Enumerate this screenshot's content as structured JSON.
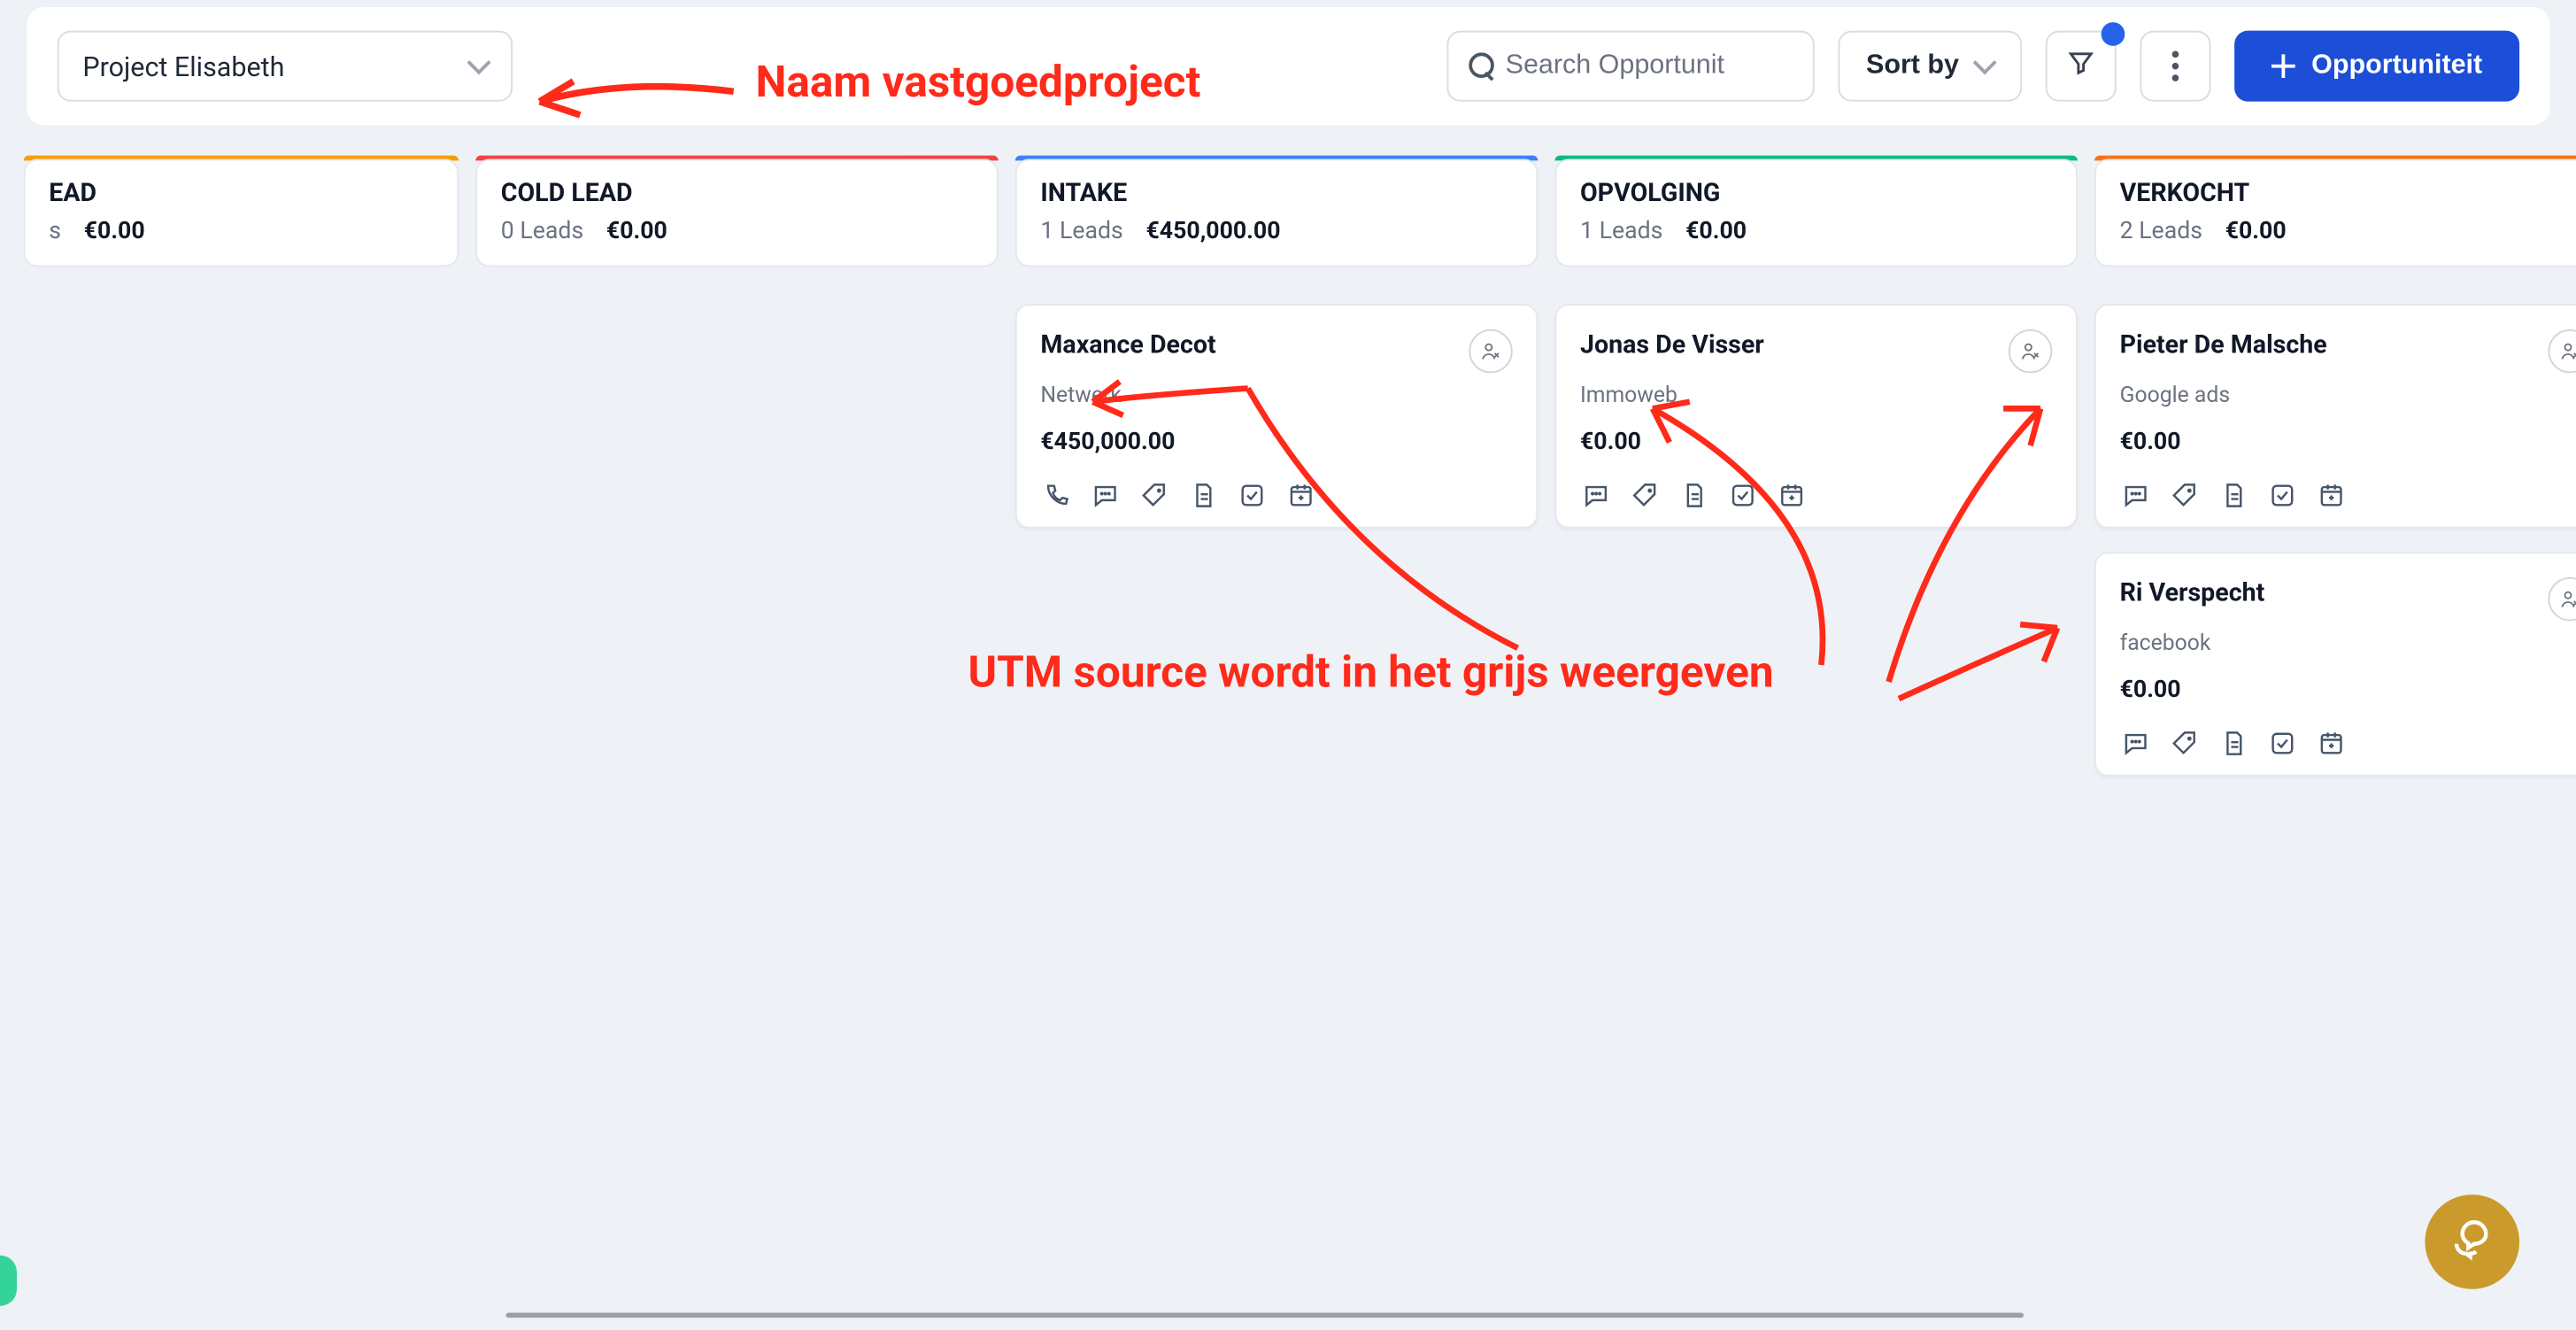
{
  "toolbar": {
    "project_name": "Project Elisabeth",
    "search_placeholder": "Search Opportunit",
    "sort_label": "Sort by",
    "add_label": "Opportuniteit"
  },
  "annotations": {
    "a1": "Naam vastgoedproject",
    "a2": "UTM source wordt in het grijs weergeven"
  },
  "columns": [
    {
      "title": "EAD",
      "sub_prefix": "s",
      "value": "€0.00",
      "bar": "yellow"
    },
    {
      "title": "COLD LEAD",
      "sub_prefix": "0 Leads",
      "value": "€0.00",
      "bar": "red"
    },
    {
      "title": "INTAKE",
      "sub_prefix": "1 Leads",
      "value": "€450,000.00",
      "bar": "blue"
    },
    {
      "title": "OPVOLGING",
      "sub_prefix": "1 Leads",
      "value": "€0.00",
      "bar": "green"
    },
    {
      "title": "VERKOCHT",
      "sub_prefix": "2 Leads",
      "value": "€0.00",
      "bar": "orange"
    }
  ],
  "cards": {
    "intake": [
      {
        "name": "Maxance Decot",
        "source": "Netwerk",
        "value": "€450,000.00",
        "actions": [
          "phone",
          "chat",
          "tag",
          "doc",
          "check",
          "cal"
        ]
      }
    ],
    "opvolging": [
      {
        "name": "Jonas De Visser",
        "source": "Immoweb",
        "value": "€0.00",
        "actions": [
          "chat",
          "tag",
          "doc",
          "check",
          "cal"
        ]
      }
    ],
    "verkocht": [
      {
        "name": "Pieter De Malsche",
        "source": "Google ads",
        "value": "€0.00",
        "actions": [
          "chat",
          "tag",
          "doc",
          "check",
          "cal"
        ]
      },
      {
        "name": "Ri Verspecht",
        "source": "facebook",
        "value": "€0.00",
        "actions": [
          "chat",
          "tag",
          "doc",
          "check",
          "cal"
        ]
      }
    ]
  }
}
